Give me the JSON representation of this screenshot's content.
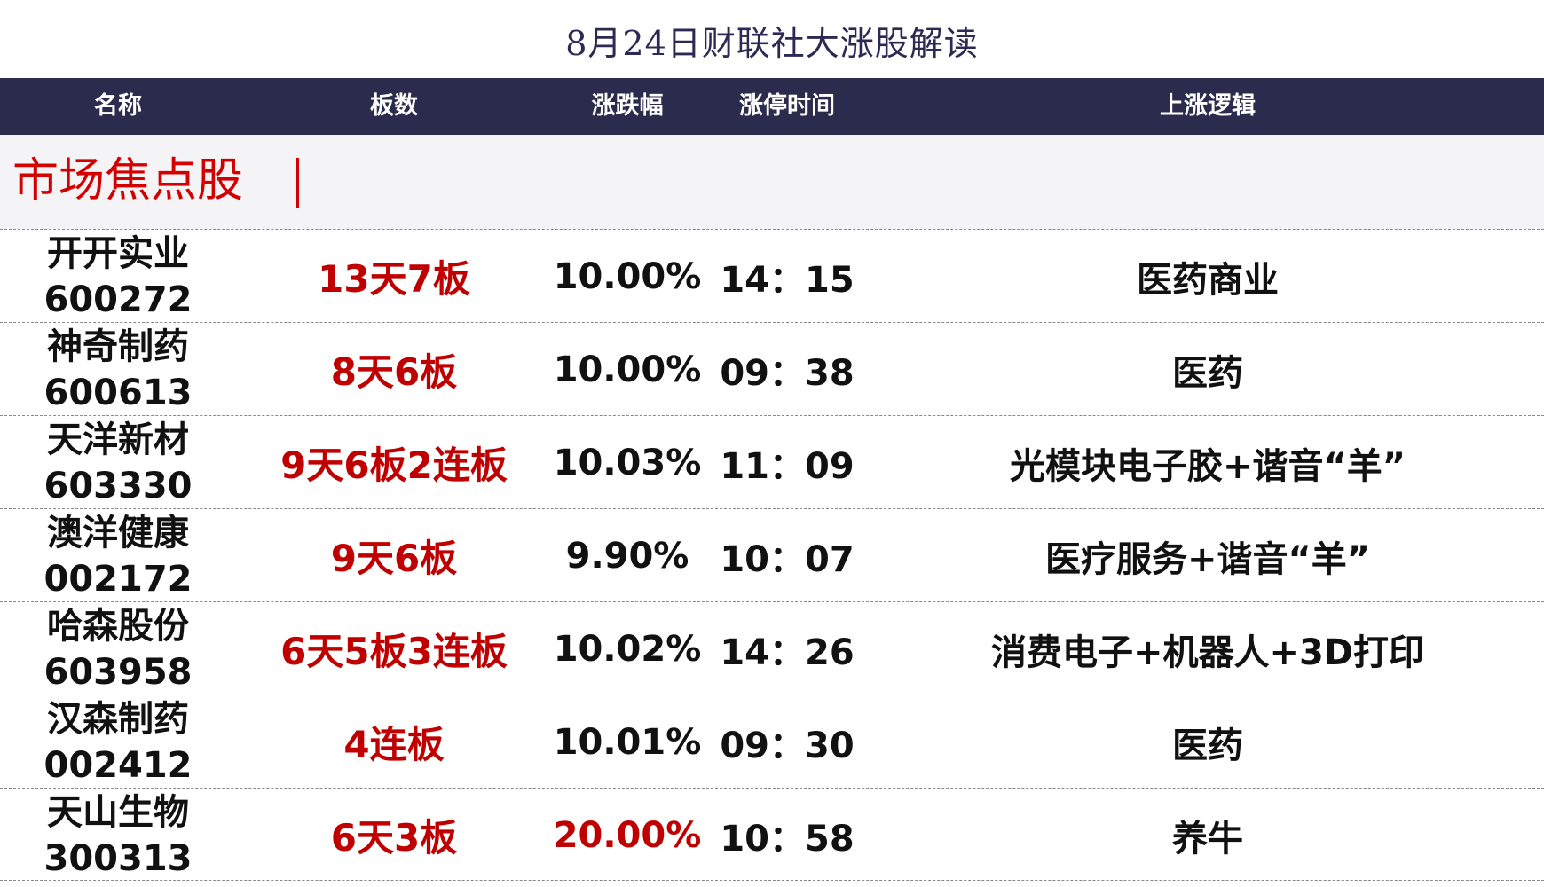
{
  "title": "8月24日财联社大涨股解读",
  "columns": {
    "name": "名称",
    "board": "板数",
    "change": "涨跌幅",
    "time": "涨停时间",
    "logic": "上涨逻辑"
  },
  "section": {
    "label": "市场焦点股"
  },
  "colors": {
    "header_bg": "#2b2b4d",
    "title_text": "#2a2a55",
    "highlight_red": "#c00000",
    "section_red": "#d40000"
  },
  "rows": [
    {
      "name": "开开实业",
      "code": "600272",
      "board": "13天7板",
      "change": "10.00%",
      "time": "14：15",
      "logic": "医药商业"
    },
    {
      "name": "神奇制药",
      "code": "600613",
      "board": "8天6板",
      "change": "10.00%",
      "time": "09：38",
      "logic": "医药"
    },
    {
      "name": "天洋新材",
      "code": "603330",
      "board": "9天6板2连板",
      "change": "10.03%",
      "time": "11：09",
      "logic": "光模块电子胶+谐音“羊”"
    },
    {
      "name": "澳洋健康",
      "code": "002172",
      "board": "9天6板",
      "change": "9.90%",
      "time": "10：07",
      "logic": "医疗服务+谐音“羊”"
    },
    {
      "name": "哈森股份",
      "code": "603958",
      "board": "6天5板3连板",
      "change": "10.02%",
      "time": "14：26",
      "logic": "消费电子+机器人+3D打印"
    },
    {
      "name": "汉森制药",
      "code": "002412",
      "board": "4连板",
      "change": "10.01%",
      "time": "09：30",
      "logic": "医药"
    },
    {
      "name": "天山生物",
      "code": "300313",
      "board": "6天3板",
      "change": "20.00%",
      "time": "10：58",
      "logic": "养牛"
    }
  ]
}
